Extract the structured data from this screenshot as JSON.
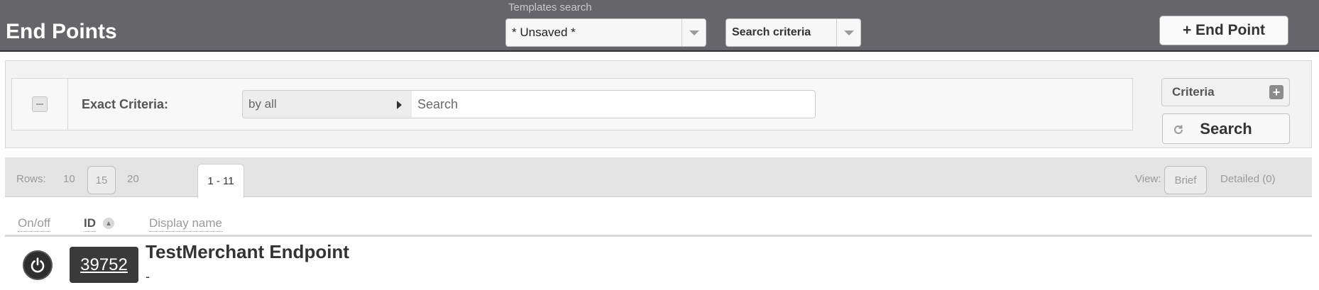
{
  "header": {
    "title": "End Points",
    "templates_label": "Templates search",
    "template_select": {
      "value": "* Unsaved *"
    },
    "criteria_select": {
      "value": "Search criteria"
    },
    "add_button": "+ End Point"
  },
  "filter": {
    "exact_criteria_label": "Exact Criteria:",
    "by_select": "by all",
    "search_placeholder": "Search",
    "criteria_button": "Criteria",
    "search_button": "Search"
  },
  "paging": {
    "rows_label": "Rows:",
    "row_options": [
      "10",
      "15",
      "20"
    ],
    "selected_rows": "15",
    "range": "1 - 11",
    "view_label": "View:",
    "view_brief": "Brief",
    "view_detailed": "Detailed (0)"
  },
  "table": {
    "columns": [
      "On/off",
      "ID",
      "Display name"
    ],
    "rows": [
      {
        "id": "39752",
        "display_name": "TestMerchant Endpoint",
        "subtitle": "-"
      }
    ]
  },
  "colors": {
    "topbar": "#66666a",
    "badge": "#3a3a3a"
  }
}
